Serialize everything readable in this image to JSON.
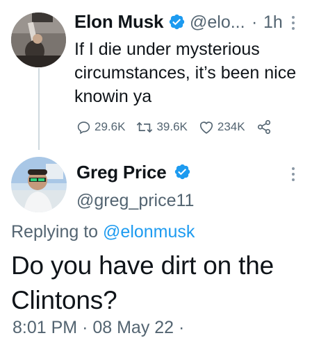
{
  "parent_tweet": {
    "author_name": "Elon Musk",
    "handle": "@elo...",
    "separator": "·",
    "time": "1h",
    "text": "If I die under mysterious circumstances, it’s been nice knowin ya",
    "stats": {
      "replies": "29.6K",
      "retweets": "39.6K",
      "likes": "234K"
    },
    "icons": [
      "verified-badge-icon",
      "more-icon",
      "reply-icon",
      "retweet-icon",
      "like-icon",
      "share-icon"
    ]
  },
  "main_tweet": {
    "author_name": "Greg Price",
    "handle": "@greg_price11",
    "replying_to_prefix": "Replying to",
    "replying_to_handle": "@elonmusk",
    "text": "Do you have dirt on the Clintons?",
    "time": "8:01 PM",
    "date": "08 May 22",
    "separator": "·",
    "trailing": "·"
  },
  "colors": {
    "accent": "#1d9bf0",
    "text": "#0f1419",
    "muted": "#536471",
    "thread_line": "#cfd9de"
  }
}
